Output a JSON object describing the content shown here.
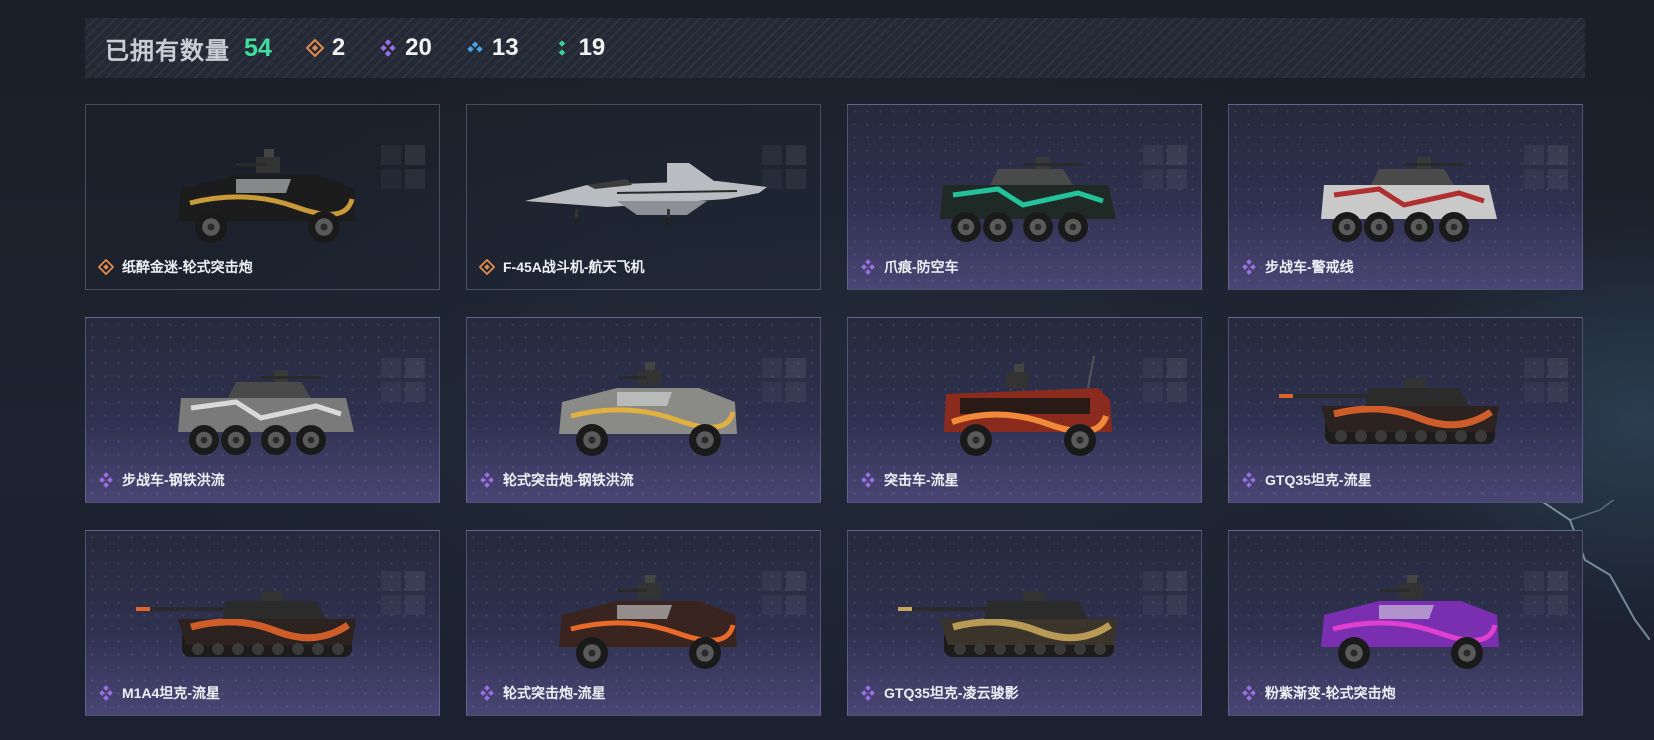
{
  "summary": {
    "title": "已拥有数量",
    "total": "54",
    "rarities": [
      {
        "icon": "legendary-rarity-icon",
        "count": "2",
        "color": "#e08a4a"
      },
      {
        "icon": "epic-rarity-icon",
        "count": "20",
        "color": "#9a6ee6"
      },
      {
        "icon": "rare-rarity-icon",
        "count": "13",
        "color": "#4aa3e8"
      },
      {
        "icon": "uncommon-rarity-icon",
        "count": "19",
        "color": "#3fd39a"
      }
    ]
  },
  "colors": {
    "legendary": "#e08a4a",
    "epic": "#9a6ee6",
    "total_accent": "#3fe0a0"
  },
  "items": [
    {
      "name": "纸醉金迷-轮式突击炮",
      "rarity": "legendary",
      "vehicle": "wheeled-assault-gun"
    },
    {
      "name": "F-45A战斗机-航天飞机",
      "rarity": "legendary",
      "vehicle": "fighter-jet"
    },
    {
      "name": "爪痕-防空车",
      "rarity": "epic",
      "vehicle": "anti-air-vehicle"
    },
    {
      "name": "步战车-警戒线",
      "rarity": "epic",
      "vehicle": "infantry-fighting-vehicle"
    },
    {
      "name": "步战车-钢铁洪流",
      "rarity": "epic",
      "vehicle": "infantry-fighting-vehicle"
    },
    {
      "name": "轮式突击炮-钢铁洪流",
      "rarity": "epic",
      "vehicle": "wheeled-assault-gun"
    },
    {
      "name": "突击车-流星",
      "rarity": "epic",
      "vehicle": "assault-vehicle"
    },
    {
      "name": "GTQ35坦克-流星",
      "rarity": "epic",
      "vehicle": "tank"
    },
    {
      "name": "M1A4坦克-流星",
      "rarity": "epic",
      "vehicle": "tank"
    },
    {
      "name": "轮式突击炮-流星",
      "rarity": "epic",
      "vehicle": "wheeled-assault-gun"
    },
    {
      "name": "GTQ35坦克-凌云骏影",
      "rarity": "epic",
      "vehicle": "tank"
    },
    {
      "name": "粉紫渐变-轮式突击炮",
      "rarity": "epic",
      "vehicle": "wheeled-assault-gun"
    }
  ]
}
